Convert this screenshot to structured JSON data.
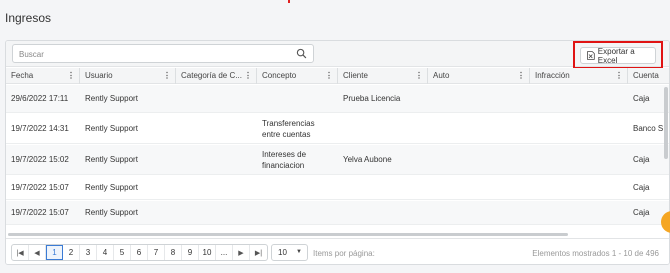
{
  "page_title": "Ingresos",
  "search": {
    "placeholder": "Buscar",
    "value": ""
  },
  "export": {
    "label": "Exportar a Excel",
    "highlight_color": "#e01313"
  },
  "columns": [
    {
      "label": "Fecha"
    },
    {
      "label": "Usuario"
    },
    {
      "label": "Categoría de C..."
    },
    {
      "label": "Concepto"
    },
    {
      "label": "Cliente"
    },
    {
      "label": "Auto"
    },
    {
      "label": "Infracción"
    },
    {
      "label": "Cuenta"
    }
  ],
  "rows": [
    {
      "fecha": "29/6/2022 17:11",
      "usuario": "Rently Support",
      "categoria": "",
      "concepto": "",
      "cliente": "Prueba Licencia",
      "auto": "",
      "infraccion": "",
      "cuenta": "Caja"
    },
    {
      "fecha": "19/7/2022 14:31",
      "usuario": "Rently Support",
      "categoria": "",
      "concepto": "Transferencias entre cuentas",
      "cliente": "",
      "auto": "",
      "infraccion": "",
      "cuenta": "Banco S"
    },
    {
      "fecha": "19/7/2022 15:02",
      "usuario": "Rently Support",
      "categoria": "",
      "concepto": "Intereses de financiacion",
      "cliente": "Yelva Aubone",
      "auto": "",
      "infraccion": "",
      "cuenta": "Caja"
    },
    {
      "fecha": "19/7/2022 15:07",
      "usuario": "Rently Support",
      "categoria": "",
      "concepto": "",
      "cliente": "",
      "auto": "",
      "infraccion": "",
      "cuenta": "Caja"
    },
    {
      "fecha": "19/7/2022 15:07",
      "usuario": "Rently Support",
      "categoria": "",
      "concepto": "",
      "cliente": "",
      "auto": "",
      "infraccion": "",
      "cuenta": "Caja"
    }
  ],
  "pager": {
    "pages": [
      "1",
      "2",
      "3",
      "4",
      "5",
      "6",
      "7",
      "8",
      "9",
      "10",
      "..."
    ],
    "active_page": "1",
    "page_size": "10",
    "items_per_page_label": "Items por página:",
    "count_text": "Elementos mostrados 1 - 10 de 496"
  },
  "colors": {
    "accent": "#3a7bd5",
    "highlight": "#e01313",
    "floating": "#f5a623"
  }
}
